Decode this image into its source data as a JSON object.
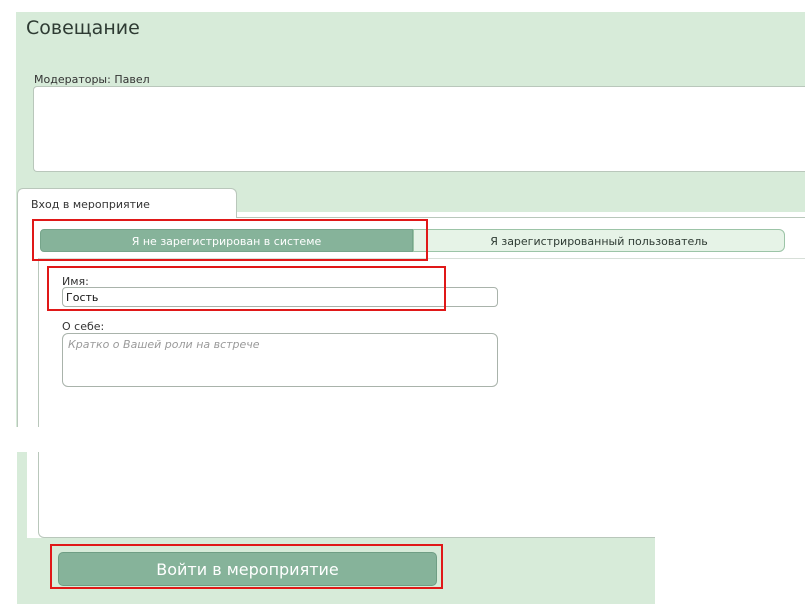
{
  "meeting": {
    "title": "Совещание",
    "moderators": "Модераторы: Павел"
  },
  "tabs": [
    {
      "label": "Вход в мероприятие"
    }
  ],
  "login_mode": {
    "unregistered": "Я не зарегистрирован в системе",
    "registered": "Я зарегистрированный пользователь",
    "selected": "unregistered"
  },
  "form": {
    "name_label": "Имя:",
    "name_value": "Гость",
    "about_label": "О себе:",
    "about_placeholder": "Кратко о Вашей роли на встрече"
  },
  "submit_button": "Войти в мероприятие",
  "colors": {
    "panel": "#d7ebd9",
    "accent": "#86b39a",
    "highlight": "#e01818"
  }
}
